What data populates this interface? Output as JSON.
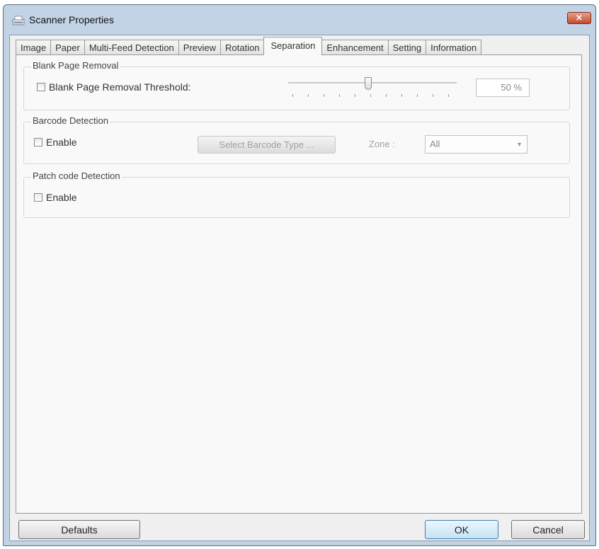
{
  "window": {
    "title": "Scanner Properties",
    "close_label": "×"
  },
  "tabs": [
    {
      "label": "Image",
      "active": false
    },
    {
      "label": "Paper",
      "active": false
    },
    {
      "label": "Multi-Feed Detection",
      "active": false
    },
    {
      "label": "Preview",
      "active": false
    },
    {
      "label": "Rotation",
      "active": false
    },
    {
      "label": "Separation",
      "active": true
    },
    {
      "label": "Enhancement",
      "active": false
    },
    {
      "label": "Setting",
      "active": false
    },
    {
      "label": "Information",
      "active": false
    }
  ],
  "blank_page": {
    "group_title": "Blank Page Removal",
    "checkbox_label": "Blank Page Removal Threshold:",
    "checked": false,
    "threshold_value": "50 %",
    "threshold_percent": 50
  },
  "barcode": {
    "group_title": "Barcode Detection",
    "checkbox_label": "Enable",
    "checked": false,
    "select_type_button": "Select Barcode Type ...",
    "zone_label": "Zone :",
    "zone_value": "All"
  },
  "patch_code": {
    "group_title": "Patch code Detection",
    "checkbox_label": "Enable",
    "checked": false
  },
  "buttons": {
    "defaults": "Defaults",
    "ok": "OK",
    "cancel": "Cancel"
  },
  "icons": {
    "app": "scanner-icon",
    "close": "close-icon",
    "dropdown": "chevron-down-icon"
  }
}
